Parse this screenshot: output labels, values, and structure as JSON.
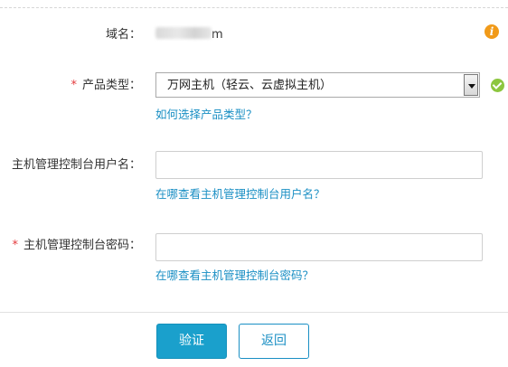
{
  "form": {
    "domain": {
      "label": "域名：",
      "value_suffix": "m"
    },
    "product_type": {
      "required_mark": "*",
      "label": "产品类型：",
      "selected": "万网主机（轻云、云虚拟主机）",
      "help_link": "如何选择产品类型？"
    },
    "username": {
      "label": "主机管理控制台用户名：",
      "value": "",
      "help_link": "在哪查看主机管理控制台用户名？"
    },
    "password": {
      "required_mark": "*",
      "label": "主机管理控制台密码：",
      "value": "",
      "help_link": "在哪查看主机管理控制台密码？"
    }
  },
  "buttons": {
    "verify": "验证",
    "back": "返回"
  },
  "icons": {
    "info": "i"
  },
  "colors": {
    "accent": "#1aa0cc",
    "link": "#1a8fc4",
    "required": "#e4393c",
    "info": "#f19a19",
    "ok": "#8cc63f"
  }
}
